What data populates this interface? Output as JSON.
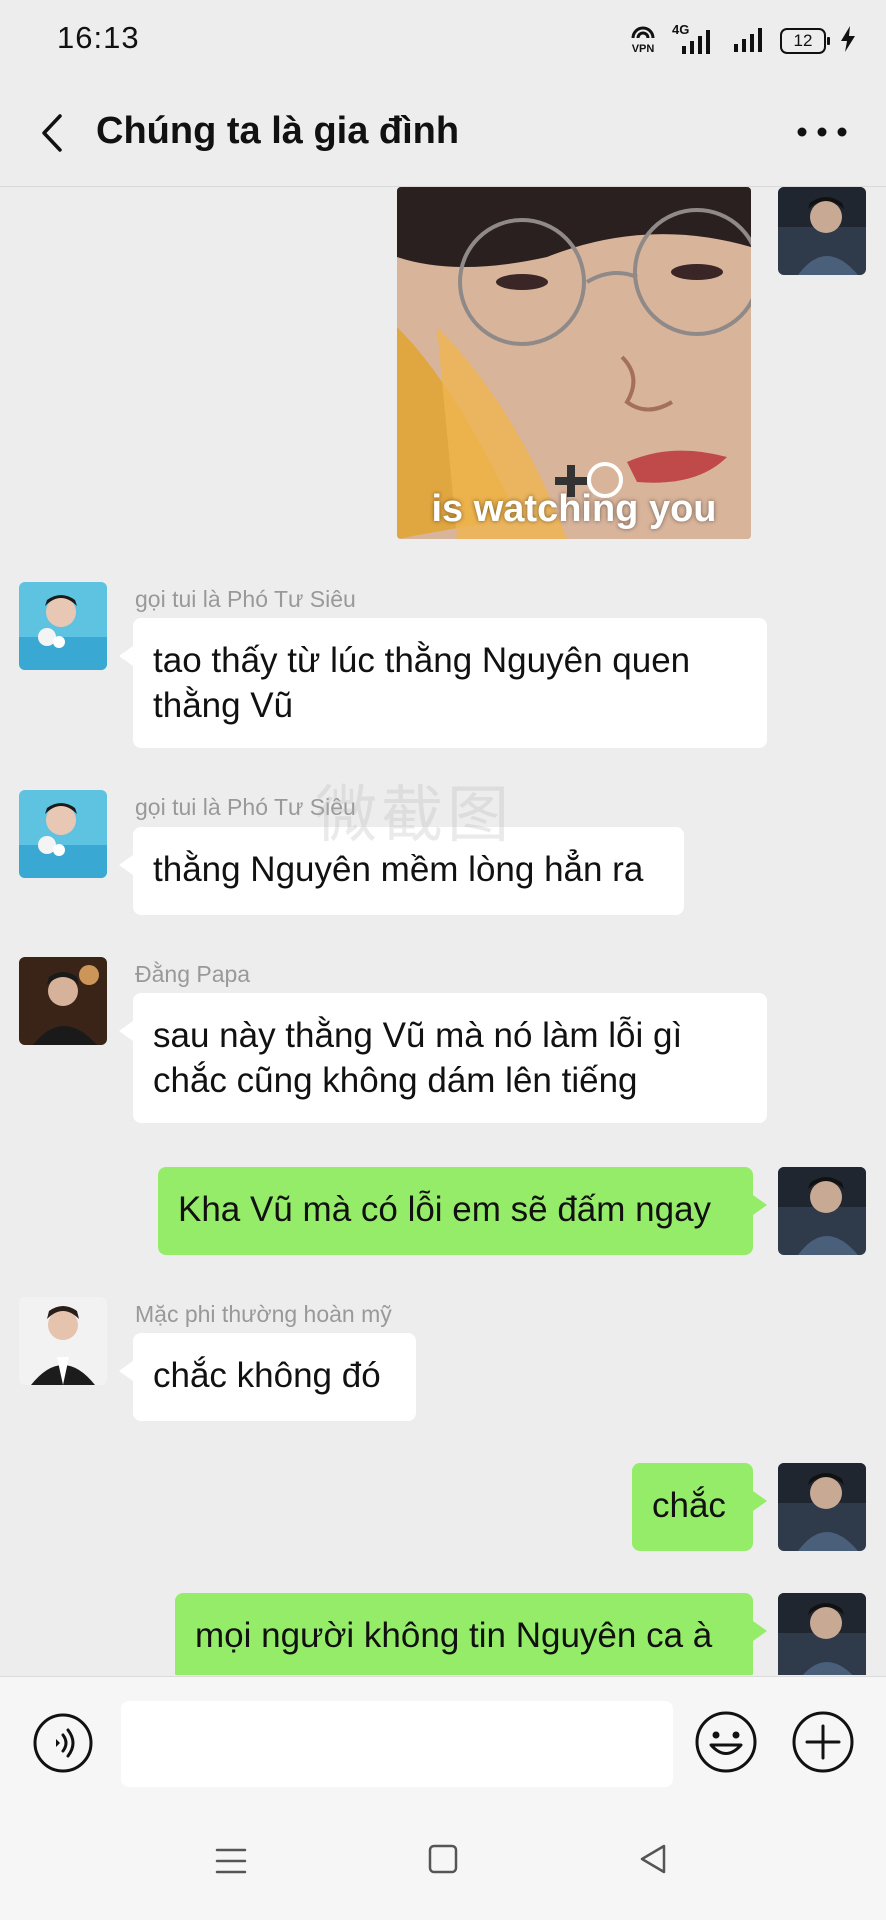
{
  "status_bar": {
    "time": "16:13",
    "vpn_label": "VPN",
    "network_label": "4G",
    "battery_level": "12"
  },
  "header": {
    "title": "Chúng ta là gia đình"
  },
  "sticker": {
    "caption": "is watching you"
  },
  "watermark": {
    "text": "微截图"
  },
  "messages": [
    {
      "sender": "gọi tui là Phó Tư Siêu",
      "text": "tao thấy từ lúc thằng Nguyên quen thằng Vũ"
    },
    {
      "sender": "gọi tui là Phó Tư Siêu",
      "text": "thằng Nguyên mềm lòng hẳn ra"
    },
    {
      "sender": "Đằng Papa",
      "text": "sau này thằng Vũ mà nó làm lỗi gì chắc cũng không dám lên tiếng"
    },
    {
      "sender": "",
      "text": "Kha Vũ mà có lỗi em sẽ đấm ngay"
    },
    {
      "sender": "Mặc phi thường hoàn mỹ",
      "text": "chắc không đó"
    },
    {
      "sender": "",
      "text": "chắc"
    },
    {
      "sender": "",
      "text": "mọi người không tin Nguyên ca à"
    }
  ],
  "colors": {
    "outgoing_bubble": "#95ec69",
    "incoming_bubble": "#ffffff",
    "background": "#ededed"
  },
  "icons": {
    "back": "chevron-left-icon",
    "more": "more-dots-icon",
    "voice": "voice-icon",
    "emoji": "emoji-icon",
    "plus": "plus-icon"
  }
}
